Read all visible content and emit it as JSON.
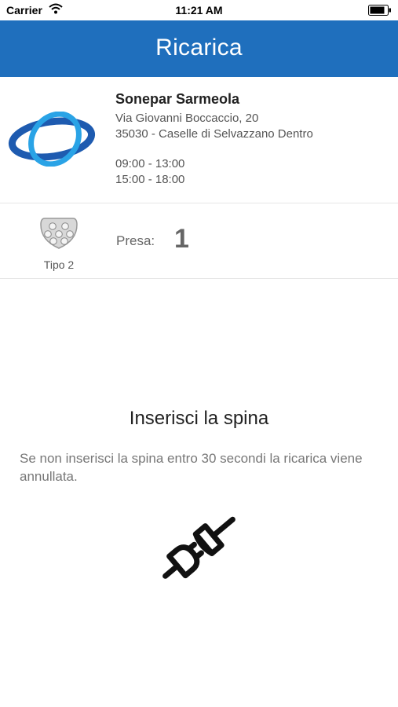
{
  "status_bar": {
    "carrier": "Carrier",
    "time": "11:21 AM"
  },
  "nav": {
    "title": "Ricarica"
  },
  "station": {
    "name": "Sonepar Sarmeola",
    "address_line1": "Via Giovanni Boccaccio, 20",
    "address_line2": "35030 - Caselle di Selvazzano Dentro",
    "hours": [
      "09:00 - 13:00",
      "15:00 - 18:00"
    ]
  },
  "connector": {
    "type_label": "Tipo 2",
    "presa_label": "Presa:",
    "presa_number": "1"
  },
  "instruction": {
    "title": "Inserisci la spina",
    "text": "Se non inserisci la spina entro 30 secondi la ricarica viene annullata."
  },
  "colors": {
    "nav_bar": "#1f6fbd",
    "logo_primary": "#1e5bb0",
    "logo_accent": "#2aa3e6"
  },
  "icons": {
    "station_logo": "sonepar-logo",
    "connector": "type2-connector-icon",
    "unplug": "unplugged-plug-icon",
    "wifi": "wifi-icon",
    "battery": "battery-icon"
  }
}
